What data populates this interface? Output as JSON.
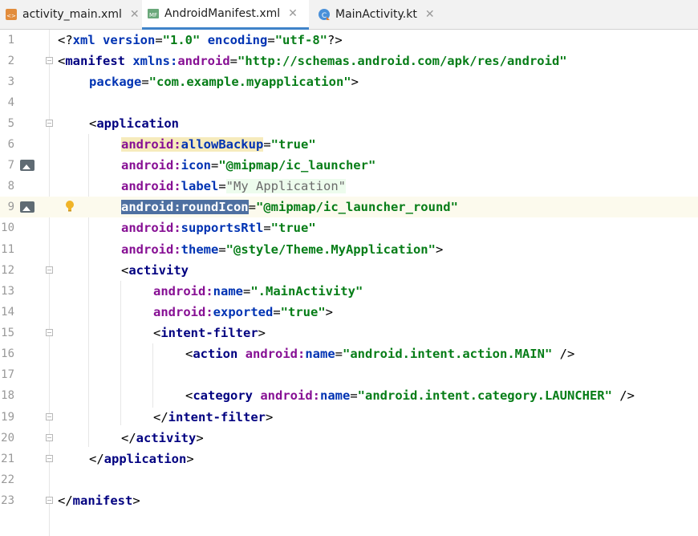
{
  "tabs": [
    {
      "label": "activity_main.xml",
      "icon": "xml-layout-icon",
      "active": false
    },
    {
      "label": "AndroidManifest.xml",
      "icon": "manifest-icon",
      "active": true
    },
    {
      "label": "MainActivity.kt",
      "icon": "kotlin-class-icon",
      "active": false
    }
  ],
  "close_glyph": "✕",
  "lines": [
    {
      "n": "1"
    },
    {
      "n": "2"
    },
    {
      "n": "3"
    },
    {
      "n": "4"
    },
    {
      "n": "5"
    },
    {
      "n": "6"
    },
    {
      "n": "7"
    },
    {
      "n": "8"
    },
    {
      "n": "9"
    },
    {
      "n": "10"
    },
    {
      "n": "11"
    },
    {
      "n": "12"
    },
    {
      "n": "13"
    },
    {
      "n": "14"
    },
    {
      "n": "15"
    },
    {
      "n": "16"
    },
    {
      "n": "17"
    },
    {
      "n": "18"
    },
    {
      "n": "19"
    },
    {
      "n": "20"
    },
    {
      "n": "21"
    },
    {
      "n": "22"
    },
    {
      "n": "23"
    }
  ],
  "code": {
    "l1": {
      "open": "<?",
      "xml": "xml ",
      "version_attr": "version",
      "eq1": "=",
      "version_val": "\"1.0\"",
      "sp": " ",
      "enc_attr": "encoding",
      "eq2": "=",
      "enc_val": "\"utf-8\"",
      "close": "?>"
    },
    "l2": {
      "lt": "<",
      "tag": "manifest",
      "sp": " ",
      "xmlns": "xmlns:",
      "ns": "android",
      "eq": "=",
      "val": "\"http://schemas.android.com/apk/res/android\""
    },
    "l3": {
      "attr": "package",
      "eq": "=",
      "val": "\"com.example.myapplication\"",
      "gt": ">"
    },
    "l5": {
      "lt": "<",
      "tag": "application"
    },
    "l6": {
      "ns": "android:",
      "attr": "allowBackup",
      "eq": "=",
      "val": "\"true\""
    },
    "l7": {
      "ns": "android:",
      "attr": "icon",
      "eq": "=",
      "val": "\"@mipmap/ic_launcher\""
    },
    "l8": {
      "ns": "android:",
      "attr": "label",
      "eq": "=",
      "val": "\"My Application\""
    },
    "l9": {
      "ns": "android:",
      "attr": "roundIcon",
      "eq": "=",
      "val": "\"@mipmap/ic_launcher_round\""
    },
    "l10": {
      "ns": "android:",
      "attr": "supportsRtl",
      "eq": "=",
      "val": "\"true\""
    },
    "l11": {
      "ns": "android:",
      "attr": "theme",
      "eq": "=",
      "val": "\"@style/Theme.MyApplication\"",
      "gt": ">"
    },
    "l12": {
      "lt": "<",
      "tag": "activity"
    },
    "l13": {
      "ns": "android:",
      "attr": "name",
      "eq": "=",
      "val": "\".MainActivity\""
    },
    "l14": {
      "ns": "android:",
      "attr": "exported",
      "eq": "=",
      "val": "\"true\"",
      "gt": ">"
    },
    "l15": {
      "lt": "<",
      "tag": "intent-filter",
      "gt": ">"
    },
    "l16": {
      "lt": "<",
      "tag": "action",
      "sp": " ",
      "ns": "android:",
      "attr": "name",
      "eq": "=",
      "val": "\"android.intent.action.MAIN\"",
      "end": " />"
    },
    "l18": {
      "lt": "<",
      "tag": "category",
      "sp": " ",
      "ns": "android:",
      "attr": "name",
      "eq": "=",
      "val": "\"android.intent.category.LAUNCHER\"",
      "end": " />"
    },
    "l19": {
      "lt": "</",
      "tag": "intent-filter",
      "gt": ">"
    },
    "l20": {
      "lt": "</",
      "tag": "activity",
      "gt": ">"
    },
    "l21": {
      "lt": "</",
      "tag": "application",
      "gt": ">"
    },
    "l23": {
      "lt": "</",
      "tag": "manifest",
      "gt": ">"
    }
  },
  "colors": {
    "tag": "#000080",
    "namespace": "#871094",
    "attribute": "#0033b3",
    "value": "#067d17",
    "caret_row": "#fcfaed",
    "selection": "#4e70a1",
    "tab_underline": "#4083c9"
  }
}
